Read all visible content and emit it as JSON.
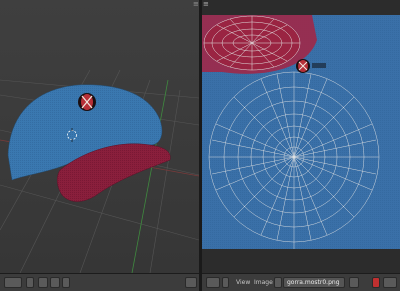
{
  "view3d": {
    "object": "baseball cap mesh",
    "header_icons": [
      "view-type-icon",
      "editor-menu-icon",
      "mode-icon",
      "shading-icon",
      "pivot-icon",
      "layers-icon"
    ]
  },
  "uv_editor": {
    "header": {
      "menu_view": "View",
      "menu_image": "Image",
      "image_name": "gorra.mostr0.png"
    },
    "header_icons": [
      "image-editor-icon",
      "pin-icon",
      "browse-image-icon",
      "close-image-icon",
      "uv-mode-icon",
      "sync-icon"
    ]
  },
  "colors": {
    "cap_blue": "#3a78b0",
    "brim_red": "#8a1f3c",
    "uv_background": "#3a70a8",
    "wire": "#d8d8d8"
  }
}
